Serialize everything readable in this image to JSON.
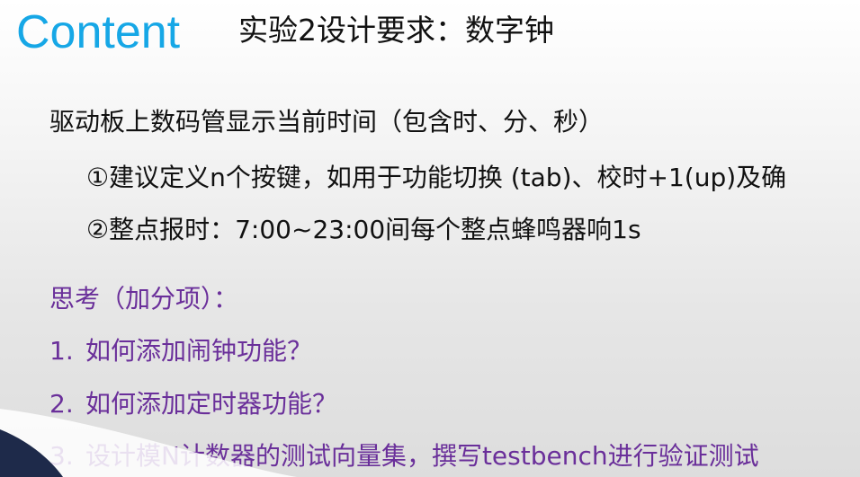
{
  "header": {
    "title": "Content",
    "subtitle": "实验2设计要求：数字钟"
  },
  "body": {
    "main": "驱动板上数码管显示当前时间（包含时、分、秒）",
    "item1": "①建议定义n个按键，如用于功能切换 (tab)、校时+1(up)及确",
    "item2": "②整点报时：7:00~23:00间每个整点蜂鸣器响1s"
  },
  "thinking": {
    "title": "思考（加分项）：",
    "items": [
      {
        "num": "1.",
        "text": "如何添加闹钟功能？"
      },
      {
        "num": "2.",
        "text": "如何添加定时器功能？"
      },
      {
        "num": "3.",
        "text": "设计模N计数器的测试向量集，撰写testbench进行验证测试"
      }
    ]
  },
  "colors": {
    "title_blue": "#16a7e6",
    "body_text": "#111111",
    "purple_text": "#6a2f9a"
  }
}
